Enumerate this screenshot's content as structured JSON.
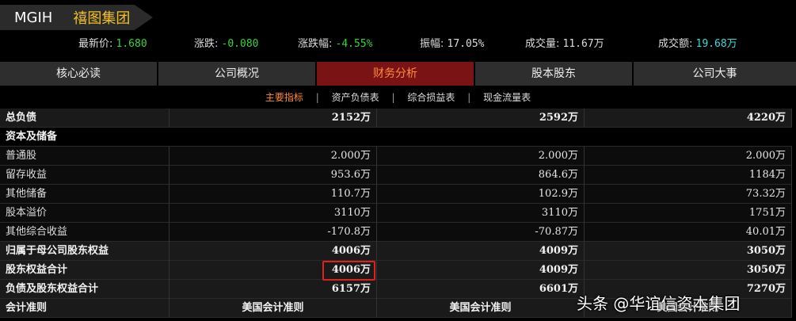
{
  "header": {
    "code": "MGIH",
    "name": "禧图集团",
    "quotes": {
      "latest_label": "最新价:",
      "latest": "1.680",
      "change_label": "涨跌:",
      "change": "-0.080",
      "pct_label": "涨跌幅:",
      "pct": "-4.55%",
      "amp_label": "振幅:",
      "amp": "17.05%",
      "vol_label": "成交量:",
      "vol": "11.67万",
      "turnover_label": "成交额:",
      "turnover": "19.68万"
    }
  },
  "tabs": [
    "核心必读",
    "公司概况",
    "财务分析",
    "股本股东",
    "公司大事"
  ],
  "subtabs": [
    "主要指标",
    "资产负债表",
    "综合损益表",
    "现金流量表"
  ],
  "rows": [
    {
      "label": "总负债",
      "v": [
        "2152万",
        "2592万",
        "4220万"
      ]
    },
    {
      "label": "资本及储备",
      "v": [
        "",
        "",
        ""
      ]
    },
    {
      "label": "普通股",
      "v": [
        "2.000万",
        "2.000万",
        "2.000万"
      ]
    },
    {
      "label": "留存收益",
      "v": [
        "953.6万",
        "864.6万",
        "1184万"
      ]
    },
    {
      "label": "其他储备",
      "v": [
        "110.7万",
        "102.9万",
        "73.32万"
      ]
    },
    {
      "label": "股本溢价",
      "v": [
        "3110万",
        "3110万",
        "1751万"
      ]
    },
    {
      "label": "其他综合收益",
      "v": [
        "-170.8万",
        "-70.87万",
        "40.01万"
      ]
    },
    {
      "label": "归属于母公司股东权益",
      "v": [
        "4006万",
        "4009万",
        "3050万"
      ]
    },
    {
      "label": "股东权益合计",
      "v": [
        "4006万",
        "4009万",
        "3050万"
      ]
    },
    {
      "label": "负债及股东权益合计",
      "v": [
        "6157万",
        "6601万",
        "7270万"
      ]
    },
    {
      "label": "会计准则",
      "v": [
        "美国会计准则",
        "美国会计准则",
        "美国会计准则"
      ]
    }
  ],
  "watermark": "头条 @华谊信资本集团",
  "colors": {
    "accent_tab": "#7a1414",
    "negative": "#37d637",
    "highlight_box": "#e02020"
  }
}
